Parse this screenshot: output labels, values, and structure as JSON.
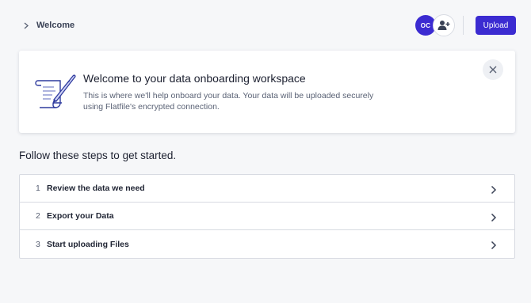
{
  "breadcrumb": {
    "label": "Welcome",
    "icon": "chevron-right-icon"
  },
  "header": {
    "avatar_initials": "OC",
    "add_user_icon": "add-user-icon",
    "upload_label": "Upload"
  },
  "welcome": {
    "icon": "scroll-quill-icon",
    "title": "Welcome to your data onboarding workspace",
    "description": "This is where we'll help onboard your data. Your data will be uploaded securely using Flatfile's encrypted connection.",
    "close_icon": "close-icon"
  },
  "steps": {
    "heading": "Follow these steps to get started.",
    "items": [
      {
        "number": "1",
        "label": "Review the data we need"
      },
      {
        "number": "2",
        "label": "Export your Data"
      },
      {
        "number": "3",
        "label": "Start uploading Files"
      }
    ]
  },
  "colors": {
    "accent": "#3b2bd1",
    "background": "#f6f7f9",
    "card": "#ffffff"
  }
}
